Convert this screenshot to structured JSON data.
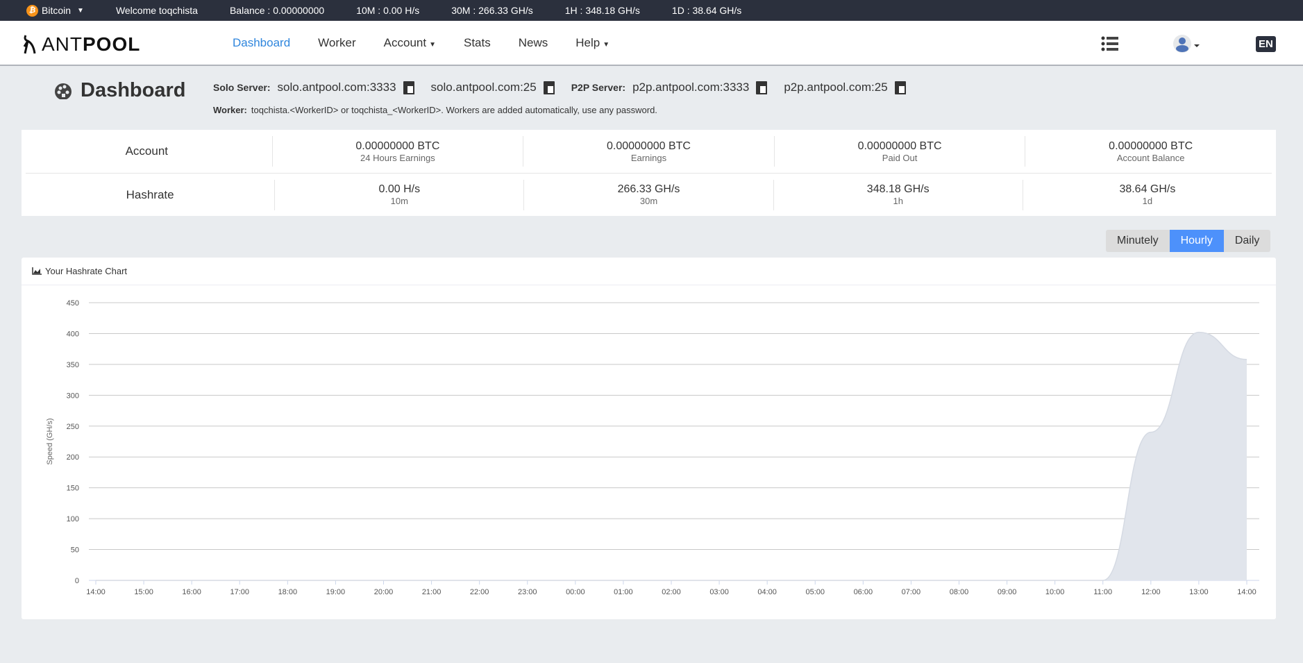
{
  "topbar": {
    "coin": "Bitcoin",
    "welcome": "Welcome toqchista",
    "balance": "Balance : 0.00000000",
    "m10": "10M : 0.00 H/s",
    "m30": "30M : 266.33 GH/s",
    "h1": "1H : 348.18 GH/s",
    "d1": "1D : 38.64 GH/s"
  },
  "nav": {
    "logo": "ANTPOOL",
    "items": [
      "Dashboard",
      "Worker",
      "Account",
      "Stats",
      "News",
      "Help"
    ],
    "lang": "EN"
  },
  "header": {
    "title": "Dashboard",
    "solo_label": "Solo Server:",
    "solo1": "solo.antpool.com:3333",
    "solo2": "solo.antpool.com:25",
    "p2p_label": "P2P Server:",
    "p2p1": "p2p.antpool.com:3333",
    "p2p2": "p2p.antpool.com:25",
    "worker_label": "Worker:",
    "worker_text": "toqchista.<WorkerID> or toqchista_<WorkerID>. Workers are added automatically, use any password."
  },
  "stats": {
    "account": {
      "label": "Account",
      "cells": [
        {
          "v": "0.00000000 BTC",
          "s": "24 Hours Earnings"
        },
        {
          "v": "0.00000000 BTC",
          "s": "Earnings"
        },
        {
          "v": "0.00000000 BTC",
          "s": "Paid Out"
        },
        {
          "v": "0.00000000 BTC",
          "s": "Account Balance"
        }
      ]
    },
    "hashrate": {
      "label": "Hashrate",
      "cells": [
        {
          "v": "0.00 H/s",
          "s": "10m"
        },
        {
          "v": "266.33 GH/s",
          "s": "30m"
        },
        {
          "v": "348.18 GH/s",
          "s": "1h"
        },
        {
          "v": "38.64 GH/s",
          "s": "1d"
        }
      ]
    }
  },
  "range": {
    "options": [
      "Minutely",
      "Hourly",
      "Daily"
    ],
    "selected": "Hourly"
  },
  "chart_data": {
    "type": "area",
    "title": "Your Hashrate Chart",
    "ylabel": "Speed (GH/s)",
    "xlabel": "",
    "ylim": [
      0,
      450
    ],
    "yticks": [
      0,
      50,
      100,
      150,
      200,
      250,
      300,
      350,
      400,
      450
    ],
    "categories": [
      "14:00",
      "15:00",
      "16:00",
      "17:00",
      "18:00",
      "19:00",
      "20:00",
      "21:00",
      "22:00",
      "23:00",
      "00:00",
      "01:00",
      "02:00",
      "03:00",
      "04:00",
      "05:00",
      "06:00",
      "07:00",
      "08:00",
      "09:00",
      "10:00",
      "11:00",
      "12:00",
      "13:00",
      "14:00"
    ],
    "values": [
      0,
      0,
      0,
      0,
      0,
      0,
      0,
      0,
      0,
      0,
      0,
      0,
      0,
      0,
      0,
      0,
      0,
      0,
      0,
      0,
      0,
      0,
      240,
      402,
      358
    ],
    "color": "#e1e5ec"
  }
}
